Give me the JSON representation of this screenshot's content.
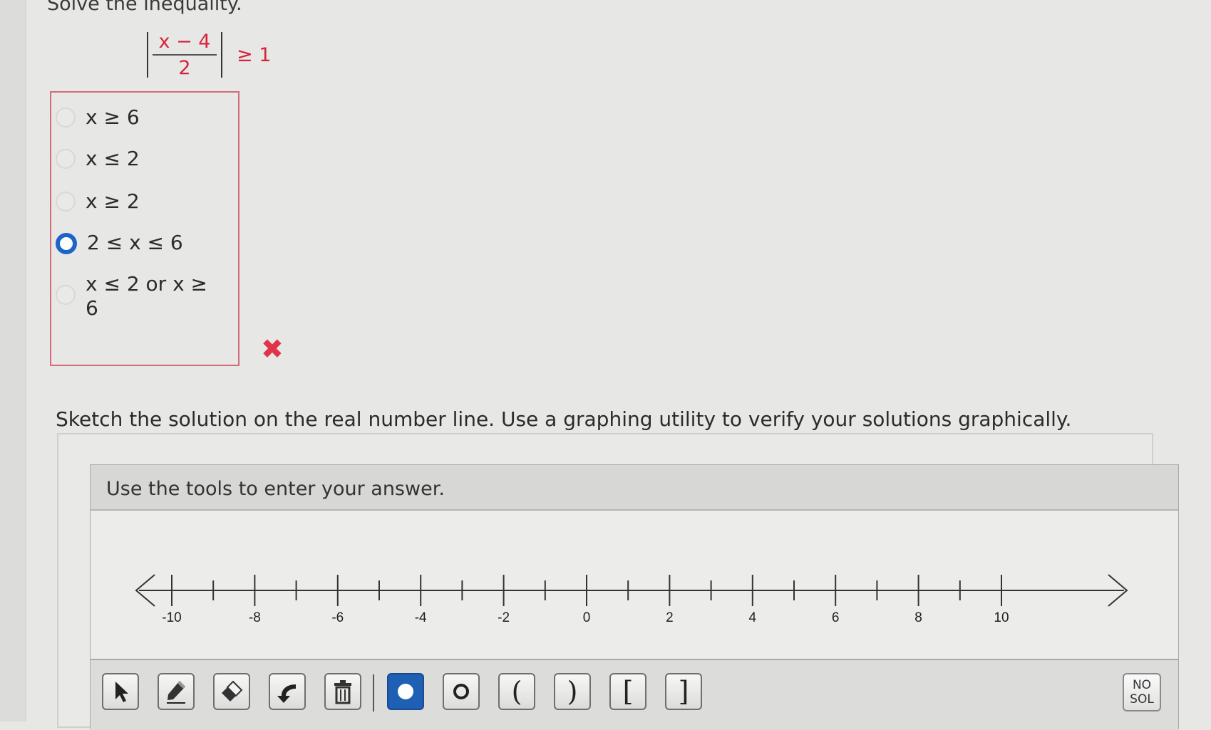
{
  "prompt": "Solve the inequality.",
  "equation": {
    "numerator": "x − 4",
    "denominator": "2",
    "relation": "≥ 1"
  },
  "choices": [
    {
      "label": "x ≥ 6",
      "selected": false
    },
    {
      "label": "x ≤ 2",
      "selected": false
    },
    {
      "label": "x ≥ 2",
      "selected": false
    },
    {
      "label": "2 ≤ x ≤ 6",
      "selected": true
    },
    {
      "label_line1": "x ≤ 2 or x ≥",
      "label_line2": "6",
      "selected": false
    }
  ],
  "feedback": {
    "icon": "x-mark-icon",
    "color": "#e0344a"
  },
  "instruction": "Sketch the solution on the real number line. Use a graphing utility to verify your solutions graphically.",
  "tool_header": "Use the tools to enter your answer.",
  "number_line": {
    "min": -11,
    "max": 11,
    "ticks": [
      -10,
      -9,
      -8,
      -7,
      -6,
      -5,
      -4,
      -3,
      -2,
      -1,
      0,
      1,
      2,
      3,
      4,
      5,
      6,
      7,
      8,
      9,
      10
    ],
    "labels": [
      "-10",
      "-8",
      "-6",
      "-4",
      "-2",
      "0",
      "2",
      "4",
      "6",
      "8",
      "10"
    ]
  },
  "toolbar": {
    "tools": [
      "arrow-select-icon",
      "pencil-icon",
      "eraser-icon",
      "undo-icon",
      "trash-icon",
      "closed-point-icon",
      "open-point-icon",
      "open-left-paren-icon",
      "open-right-paren-icon",
      "left-bracket-icon",
      "right-bracket-icon"
    ],
    "paren_left": "(",
    "paren_right": ")",
    "bracket_left": "[",
    "bracket_right": "]",
    "nosol_line1": "NO",
    "nosol_line2": "SOL"
  },
  "colors": {
    "accent": "#1f5fb4",
    "answer_red": "#d6243c",
    "border_red": "#d36b7a"
  }
}
